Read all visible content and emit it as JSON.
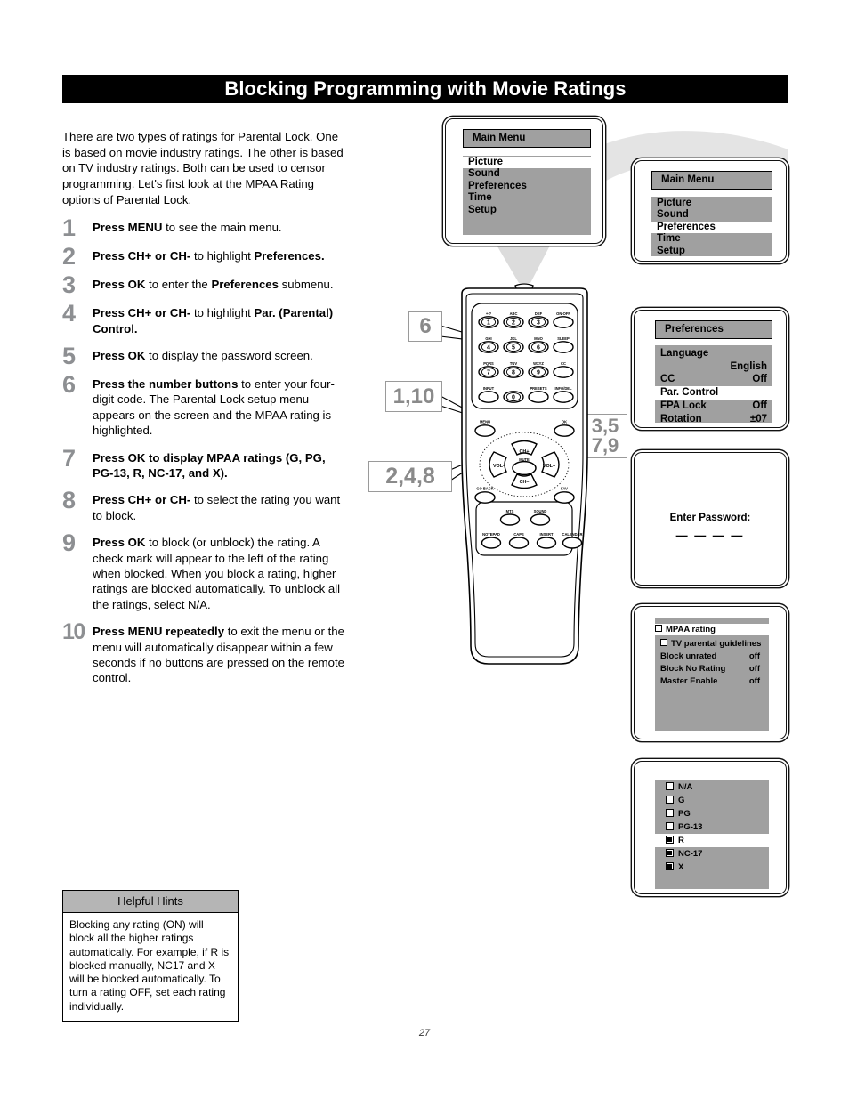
{
  "header": {
    "title": "Blocking Programming with Movie Ratings"
  },
  "intro": "There are two types of ratings for Parental Lock. One is based on movie industry ratings. The other is based on TV industry ratings. Both can be used to censor programming. Let's first look at the MPAA Rating options of Parental Lock.",
  "steps": [
    {
      "num": "1",
      "html": "<b>Press MENU</b> to see the main menu."
    },
    {
      "num": "2",
      "html": "<b>Press CH+ or CH-</b> to highlight <b>Preferences.</b>"
    },
    {
      "num": "3",
      "html": "<b>Press OK</b> to enter the <b>Preferences</b> submenu."
    },
    {
      "num": "4",
      "html": "<b>Press CH+ or CH-</b> to highlight <b>Par. (Parental) Control.</b>"
    },
    {
      "num": "5",
      "html": "<b>Press OK</b> to display the password screen."
    },
    {
      "num": "6",
      "html": "<b>Press the number buttons</b> to enter your four-digit code. The Parental Lock setup menu appears on the screen and the MPAA rating is highlighted."
    },
    {
      "num": "7",
      "html": "<b>Press OK to display MPAA ratings (G, PG, PG-13, R, NC-17, and X).</b>"
    },
    {
      "num": "8",
      "html": "<b>Press CH+ or CH-</b> to select the rating you want to block."
    },
    {
      "num": "9",
      "html": "<b>Press OK</b> to block (or unblock) the rating. A check mark will appear to the left of the rating when blocked. When you block a rating, higher ratings are blocked automatically. To unblock all the ratings, select N/A."
    },
    {
      "num": "10",
      "html": "<b>Press MENU repeatedly</b> to exit the menu or the menu will automatically disappear within a few seconds if no buttons are pressed on the remote control."
    }
  ],
  "hints": {
    "heading": "Helpful Hints",
    "body": "Blocking any rating (ON) will block all the higher ratings automatically. For example, if R is blocked manually, NC17 and X will be blocked automatically. To turn a rating OFF, set each rating individually."
  },
  "page_number": "27",
  "callouts": {
    "six": "6",
    "one_ten": "1,10",
    "two_four_eight": "2,4,8",
    "three_five": "3,5",
    "seven_nine": "7,9"
  },
  "screens": {
    "main_menu_1": {
      "title": "Main Menu",
      "items": [
        "Picture",
        "Sound",
        "Preferences",
        "Time",
        "Setup"
      ],
      "highlighted": "Picture"
    },
    "main_menu_2": {
      "title": "Main Menu",
      "items": [
        "Picture",
        "Sound",
        "Preferences",
        "Time",
        "Setup"
      ],
      "highlighted": "Preferences"
    },
    "preferences": {
      "title": "Preferences",
      "rows": [
        {
          "label": "Language",
          "value": "English",
          "highlighted": false
        },
        {
          "label": "CC",
          "value": "Off",
          "highlighted": false
        },
        {
          "label": "Par. Control",
          "value": "",
          "highlighted": true
        },
        {
          "label": "FPA Lock",
          "value": "Off",
          "highlighted": false
        },
        {
          "label": "Rotation",
          "value": "±07",
          "highlighted": false
        }
      ]
    },
    "password": {
      "label": "Enter Password:",
      "dashes": "— — — —"
    },
    "mpaa": {
      "highlighted_row": "MPAA rating",
      "rows": [
        {
          "label": "TV parental guidelines",
          "value": "",
          "checkbox": true
        },
        {
          "label": "Block unrated",
          "value": "off",
          "checkbox": false
        },
        {
          "label": "Block No Rating",
          "value": "off",
          "checkbox": false
        },
        {
          "label": "Master Enable",
          "value": "off",
          "checkbox": false
        }
      ]
    },
    "ratings": {
      "items": [
        {
          "label": "N/A",
          "checked": false,
          "highlighted": false
        },
        {
          "label": "G",
          "checked": false,
          "highlighted": false
        },
        {
          "label": "PG",
          "checked": false,
          "highlighted": false
        },
        {
          "label": "PG-13",
          "checked": false,
          "highlighted": false
        },
        {
          "label": "R",
          "checked": true,
          "highlighted": true
        },
        {
          "label": "NC-17",
          "checked": true,
          "highlighted": false
        },
        {
          "label": "X",
          "checked": true,
          "highlighted": false
        }
      ]
    }
  },
  "remote": {
    "keys": [
      {
        "label": "+-?",
        "num": "1"
      },
      {
        "label": "ABC",
        "num": "2"
      },
      {
        "label": "DEF",
        "num": "3"
      },
      {
        "label": "ON-OFF",
        "num": ""
      },
      {
        "label": "GHI",
        "num": "4"
      },
      {
        "label": "JKL",
        "num": "5"
      },
      {
        "label": "MNO",
        "num": "6"
      },
      {
        "label": "SLEEP",
        "num": ""
      },
      {
        "label": "PQRS",
        "num": "7"
      },
      {
        "label": "TUV",
        "num": "8"
      },
      {
        "label": "WXYZ",
        "num": "9"
      },
      {
        "label": "CC",
        "num": ""
      },
      {
        "label": "INPUT",
        "num": ""
      },
      {
        "label": "",
        "num": "0"
      },
      {
        "label": "PRESETS",
        "num": ""
      },
      {
        "label": "INFO/DEL",
        "num": ""
      }
    ],
    "menu_label": "MENU",
    "ok_label": "OK",
    "nav": {
      "up": "CH+",
      "down": "CH–",
      "left": "VOL–",
      "right": "VOL+",
      "center": "MUTE"
    },
    "go_back_label": "GO BACK",
    "fav_label": "FAV",
    "lower_keys": [
      "MTS",
      "SOUND",
      "NOTEPAD",
      "CAPS",
      "INSERT",
      "CALENDAR"
    ]
  },
  "colors": {
    "title_bar_bg": "#000000",
    "osd_gray": "#a0a0a0",
    "step_number": "#8d8f92",
    "callout_text": "#8a8a8a",
    "hint_head": "#b5b5b5"
  }
}
